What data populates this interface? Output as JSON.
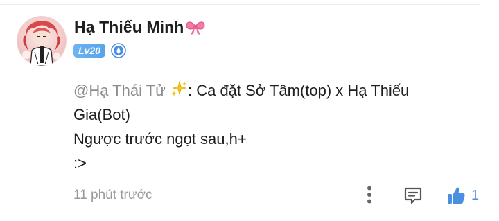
{
  "comment": {
    "username": "Hạ Thiếu Minh",
    "username_emoji": "ribbon-icon",
    "level": "Lv20",
    "verified_icon": "verified-shield-icon",
    "message": {
      "mention": "@Hạ Thái Tử",
      "mention_emoji": "sparkles-icon",
      "line1_rest": ": Ca đặt Sở Tâm(top) x Hạ Thiếu",
      "line2": "Gia(Bot)",
      "line3": "Ngược trước ngọt sau,h+",
      "line4": ":>"
    },
    "time": "11 phút trước",
    "like_count": "1"
  },
  "colors": {
    "accent": "#4a8fe0",
    "level_badge": "#5aa3ea",
    "muted_text": "#9a9a9a",
    "text": "#1f1f1f"
  }
}
